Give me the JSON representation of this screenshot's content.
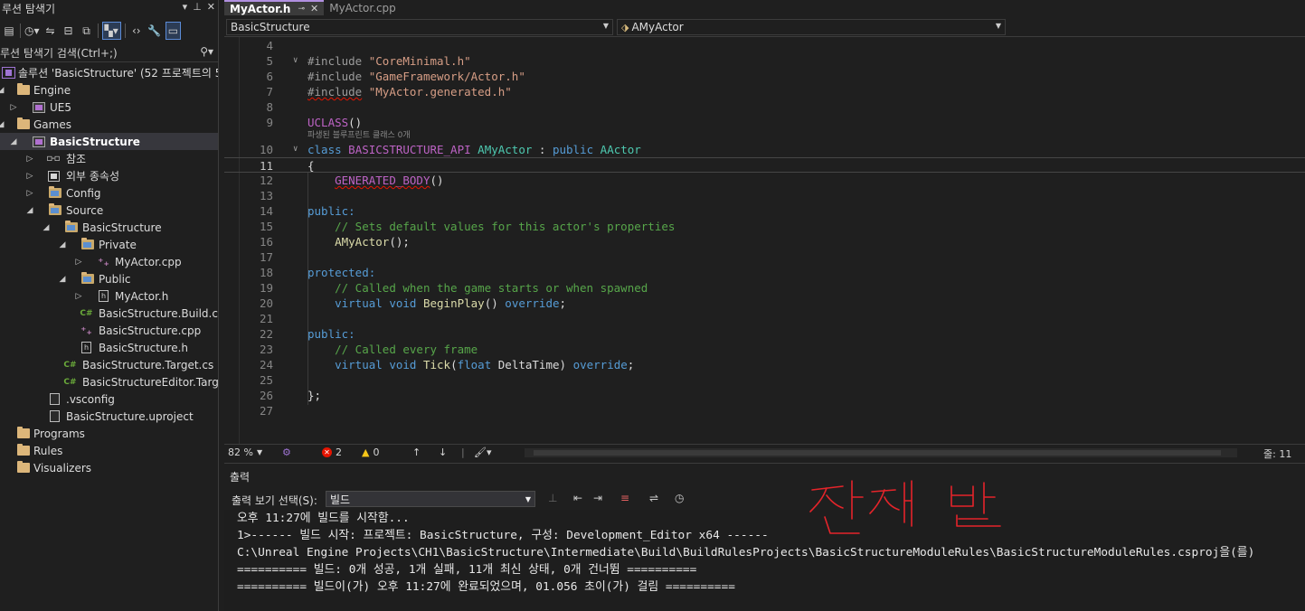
{
  "solution_explorer": {
    "title": "루션 탐색기",
    "search_label": "루션 탐색기 검색(Ctrl+;)",
    "solution_label": "솔루션 'BasicStructure'  (52 프로젝트의 5",
    "tree": [
      {
        "label": "Engine",
        "icon": "folder-icon"
      },
      {
        "label": "UE5",
        "icon": "project-icon"
      },
      {
        "label": "Games",
        "icon": "folder-icon"
      },
      {
        "label": "BasicStructure",
        "icon": "project-icon"
      },
      {
        "label": "참조",
        "icon": "references-icon"
      },
      {
        "label": "외부 종속성",
        "icon": "dependencies-icon"
      },
      {
        "label": "Config",
        "icon": "filter-folder-icon"
      },
      {
        "label": "Source",
        "icon": "filter-folder-icon"
      },
      {
        "label": "BasicStructure",
        "icon": "filter-folder-icon"
      },
      {
        "label": "Private",
        "icon": "filter-folder-icon"
      },
      {
        "label": "MyActor.cpp",
        "icon": "cpp-file-icon"
      },
      {
        "label": "Public",
        "icon": "filter-folder-icon"
      },
      {
        "label": "MyActor.h",
        "icon": "header-file-icon"
      },
      {
        "label": "BasicStructure.Build.cs",
        "icon": "csharp-file-icon"
      },
      {
        "label": "BasicStructure.cpp",
        "icon": "cpp-file-icon"
      },
      {
        "label": "BasicStructure.h",
        "icon": "header-file-icon"
      },
      {
        "label": "BasicStructure.Target.cs",
        "icon": "csharp-file-icon"
      },
      {
        "label": "BasicStructureEditor.Target.c",
        "icon": "csharp-file-icon"
      },
      {
        "label": ".vsconfig",
        "icon": "document-icon"
      },
      {
        "label": "BasicStructure.uproject",
        "icon": "document-icon"
      },
      {
        "label": "Programs",
        "icon": "folder-icon"
      },
      {
        "label": "Rules",
        "icon": "folder-icon"
      },
      {
        "label": "Visualizers",
        "icon": "folder-icon"
      }
    ]
  },
  "editor": {
    "tabs": [
      {
        "label": "MyActor.h",
        "active": true
      },
      {
        "label": "MyActor.cpp",
        "active": false
      }
    ],
    "nav_project": "BasicStructure",
    "nav_scope": "AMyActor",
    "line_numbers": [
      "4",
      "5",
      "6",
      "7",
      "8",
      "9",
      "10",
      "11",
      "12",
      "13",
      "14",
      "15",
      "16",
      "17",
      "18",
      "19",
      "20",
      "21",
      "22",
      "23",
      "24",
      "25",
      "26",
      "27"
    ],
    "hint_text": "파생된 블루프린트 클래스 0개",
    "code": {
      "inc": "#include",
      "inc1": "\"CoreMinimal.h\"",
      "inc2": "\"GameFramework/Actor.h\"",
      "inc3": "\"MyActor.generated.h\"",
      "uclass": "UCLASS",
      "parens": "()",
      "kw_class": "class",
      "api": "BASICSTRUCTURE_API",
      "cls": "AMyActor",
      "colon": ":",
      "kw_public": "public",
      "base": "AActor",
      "brace_open": "{",
      "gen_body": "GENERATED_BODY",
      "public_label": "public:",
      "comment1": "// Sets default values for this actor's properties",
      "ctor": "AMyActor",
      "ctor_end": "();",
      "protected_label": "protected:",
      "comment2": "// Called when the game starts or when spawned",
      "kw_virtual": "virtual",
      "kw_void": "void",
      "begin_play": "BeginPlay",
      "kw_override": "override",
      "semi": ";",
      "comment3": "// Called every frame",
      "tick": "Tick",
      "kw_float": "float",
      "delta": "DeltaTime",
      "brace_close": "};"
    },
    "status": {
      "zoom": "82 %",
      "errors": "2",
      "warnings": "0",
      "line_col": "줄: 11"
    }
  },
  "output": {
    "title": "출력",
    "show_label": "출력 보기 선택(S):",
    "source_selected": "빌드",
    "lines": [
      "오후 11:27에 빌드를 시작함...",
      "1>------ 빌드 시작: 프로젝트: BasicStructure, 구성: Development_Editor x64 ------",
      "C:\\Unreal Engine Projects\\CH1\\BasicStructure\\Intermediate\\Build\\BuildRulesProjects\\BasicStructureModuleRules\\BasicStructureModuleRules.csproj을(를)",
      "========== 빌드: 0개 성공, 1개 실패, 11개 최신 상태, 0개 건너뜀 ==========",
      "========== 빌드이(가) 오후 11:27에 완료되었으며, 01.056 초이(가) 걸림 =========="
    ],
    "annotation_color": "#e5242a"
  },
  "colors": {
    "background": "#1f1f1f",
    "keyword": "#569cd6",
    "string": "#d69d85",
    "comment": "#57a64a",
    "macro": "#bd63c5",
    "type": "#4ec9b0",
    "function": "#dcdcaa",
    "accent": "#b18fe0"
  }
}
